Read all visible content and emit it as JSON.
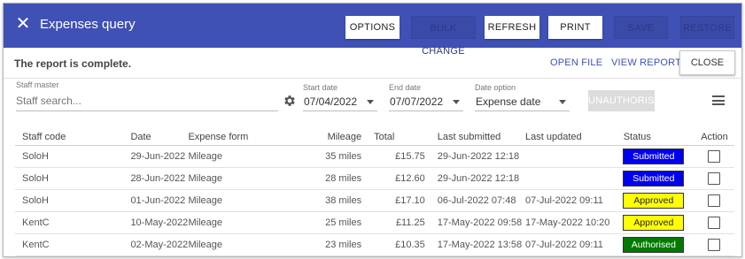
{
  "header": {
    "title": "Expenses query",
    "buttons": {
      "options": "OPTIONS",
      "bulk_change": "BULK CHANGE",
      "refresh": "REFRESH",
      "print": "PRINT",
      "save": "SAVE",
      "restore": "RESTORE"
    }
  },
  "status_bar": {
    "message": "The report is complete.",
    "open_file": "OPEN FILE",
    "view_report": "VIEW REPORT",
    "close": "CLOSE"
  },
  "filters": {
    "staff_master": {
      "label": "Staff master",
      "placeholder": "Staff search..."
    },
    "start_date": {
      "label": "Start date",
      "value": "07/04/2022"
    },
    "end_date": {
      "label": "End date",
      "value": "07/07/2022"
    },
    "date_option": {
      "label": "Date option",
      "value": "Expense date"
    },
    "unauthorise": "UNAUTHORISE"
  },
  "table": {
    "columns": [
      "Staff code",
      "Date",
      "Expense form",
      "Mileage",
      "Total",
      "Last submitted",
      "Last updated",
      "Status",
      "Action"
    ],
    "rows": [
      {
        "staff": "SoloH",
        "date": "29-Jun-2022",
        "form": "Mileage",
        "mileage": "35 miles",
        "total": "£15.75",
        "submitted": "29-Jun-2022 12:18",
        "updated": "",
        "status": "Submitted"
      },
      {
        "staff": "SoloH",
        "date": "28-Jun-2022",
        "form": "Mileage",
        "mileage": "28 miles",
        "total": "£12.60",
        "submitted": "29-Jun-2022 12:18",
        "updated": "",
        "status": "Submitted"
      },
      {
        "staff": "SoloH",
        "date": "01-Jun-2022",
        "form": "Mileage",
        "mileage": "38 miles",
        "total": "£17.10",
        "submitted": "06-Jul-2022 07:48",
        "updated": "07-Jul-2022 09:11",
        "status": "Approved"
      },
      {
        "staff": "KentC",
        "date": "10-May-2022",
        "form": "Mileage",
        "mileage": "25 miles",
        "total": "£11.25",
        "submitted": "17-May-2022 09:58",
        "updated": "17-May-2022 10:20",
        "status": "Approved"
      },
      {
        "staff": "KentC",
        "date": "02-May-2022",
        "form": "Mileage",
        "mileage": "23 miles",
        "total": "£10.35",
        "submitted": "17-May-2022 13:58",
        "updated": "07-Jul-2022 09:11",
        "status": "Authorised"
      }
    ]
  },
  "status_colors": {
    "Submitted": {
      "bg": "#0000ee",
      "fg": "#ffffff"
    },
    "Approved": {
      "bg": "#ffff00",
      "fg": "#222222"
    },
    "Authorised": {
      "bg": "#007a00",
      "fg": "#ffffff"
    }
  },
  "colors": {
    "brand": "#3f51b5"
  },
  "icons": {
    "close": "close-icon",
    "settings": "gear-icon",
    "menu": "hamburger-menu-icon",
    "dropdown": "chevron-down-icon"
  }
}
